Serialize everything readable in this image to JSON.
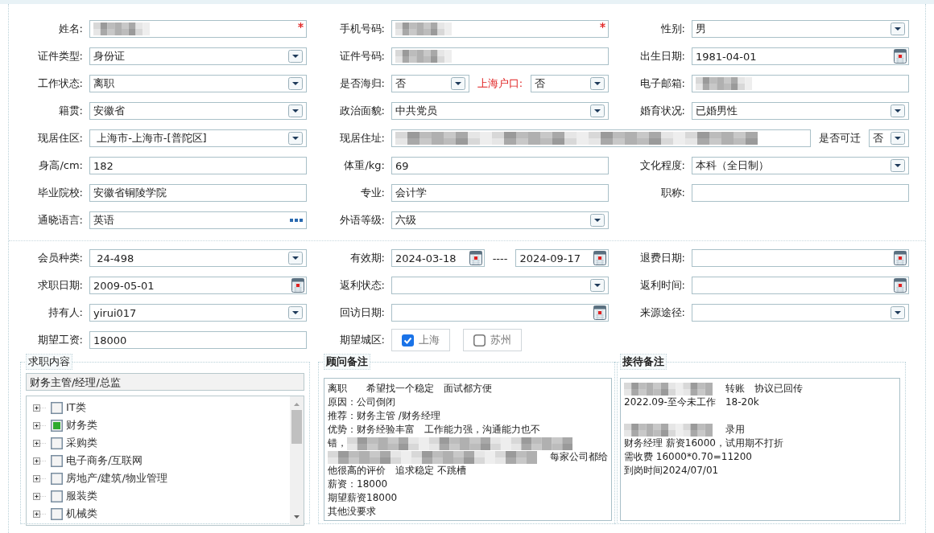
{
  "sections": [
    {
      "rows": [
        {
          "cells": [
            {
              "label": "姓名:",
              "controls": [
                {
                  "kind": "text",
                  "redacted": true,
                  "required": true
                }
              ]
            },
            {
              "label": "手机号码:",
              "controls": [
                {
                  "kind": "text",
                  "redacted": true,
                  "required": true
                }
              ]
            },
            {
              "label": "性别:",
              "controls": [
                {
                  "kind": "select",
                  "value": "男"
                }
              ]
            }
          ]
        },
        {
          "cells": [
            {
              "label": "证件类型:",
              "controls": [
                {
                  "kind": "select",
                  "value": "身份证"
                }
              ]
            },
            {
              "label": "证件号码:",
              "controls": [
                {
                  "kind": "text",
                  "redacted": true
                }
              ]
            },
            {
              "label": "出生日期:",
              "controls": [
                {
                  "kind": "date",
                  "value": "1981-04-01"
                }
              ]
            }
          ]
        },
        {
          "cells": [
            {
              "label": "工作状态:",
              "controls": [
                {
                  "kind": "select",
                  "value": "离职"
                }
              ]
            },
            {
              "label": "是否海归:",
              "controls": [
                {
                  "kind": "select",
                  "value": "否"
                },
                {
                  "kind": "label",
                  "text": "上海户口:",
                  "alert": true
                },
                {
                  "kind": "select",
                  "value": "否"
                }
              ]
            },
            {
              "label": "电子邮箱:",
              "controls": [
                {
                  "kind": "text",
                  "redacted": true
                }
              ]
            }
          ]
        },
        {
          "cells": [
            {
              "label": "籍贯:",
              "controls": [
                {
                  "kind": "select",
                  "value": "安徽省"
                }
              ]
            },
            {
              "label": "政治面貌:",
              "controls": [
                {
                  "kind": "select",
                  "value": "中共党员"
                }
              ]
            },
            {
              "label": "婚育状况:",
              "controls": [
                {
                  "kind": "select",
                  "value": "已婚男性"
                }
              ]
            }
          ]
        },
        {
          "cells": [
            {
              "label": "现居住区:",
              "controls": [
                {
                  "kind": "select",
                  "value": " 上海市-上海市-[普陀区]"
                }
              ]
            },
            {
              "label": "现居住址:",
              "wide": true,
              "controls": [
                {
                  "kind": "text",
                  "redacted": true
                },
                {
                  "kind": "label",
                  "text": "是否可迁",
                  "alert": false
                },
                {
                  "kind": "select",
                  "value": "否"
                }
              ]
            }
          ]
        },
        {
          "cells": [
            {
              "label": "身高/cm:",
              "controls": [
                {
                  "kind": "text",
                  "value": "182"
                }
              ]
            },
            {
              "label": "体重/kg:",
              "controls": [
                {
                  "kind": "text",
                  "value": "69"
                }
              ]
            },
            {
              "label": "文化程度:",
              "controls": [
                {
                  "kind": "select",
                  "value": "本科（全日制）"
                }
              ]
            }
          ]
        },
        {
          "cells": [
            {
              "label": "毕业院校:",
              "controls": [
                {
                  "kind": "text",
                  "value": "安徽省铜陵学院"
                }
              ]
            },
            {
              "label": "专业:",
              "controls": [
                {
                  "kind": "text",
                  "value": "会计学"
                }
              ]
            },
            {
              "label": "职称:",
              "controls": [
                {
                  "kind": "text"
                }
              ]
            }
          ]
        },
        {
          "cells": [
            {
              "label": "通晓语言:",
              "controls": [
                {
                  "kind": "lookup",
                  "value": "英语"
                }
              ]
            },
            {
              "label": "外语等级:",
              "controls": [
                {
                  "kind": "select",
                  "value": "六级"
                }
              ]
            }
          ]
        }
      ]
    },
    {
      "rows": [
        {
          "cells": [
            {
              "label": "会员种类:",
              "controls": [
                {
                  "kind": "select",
                  "value": " 24-498"
                }
              ]
            },
            {
              "label": "有效期:",
              "controls": [
                {
                  "kind": "date",
                  "value": "2024-03-18"
                },
                {
                  "kind": "label",
                  "text": "----",
                  "alert": false
                },
                {
                  "kind": "date",
                  "value": "2024-09-17"
                }
              ]
            },
            {
              "label": "退费日期:",
              "controls": [
                {
                  "kind": "date"
                }
              ]
            }
          ]
        },
        {
          "cells": [
            {
              "label": "求职日期:",
              "controls": [
                {
                  "kind": "date",
                  "value": "2009-05-01"
                }
              ]
            },
            {
              "label": "返利状态:",
              "controls": [
                {
                  "kind": "select"
                }
              ]
            },
            {
              "label": "返利时间:",
              "controls": [
                {
                  "kind": "date"
                }
              ]
            }
          ]
        },
        {
          "cells": [
            {
              "label": "持有人:",
              "controls": [
                {
                  "kind": "select",
                  "value": "yirui017"
                }
              ]
            },
            {
              "label": "回访日期:",
              "controls": [
                {
                  "kind": "date"
                }
              ]
            },
            {
              "label": "来源途径:",
              "controls": [
                {
                  "kind": "select"
                }
              ]
            }
          ]
        },
        {
          "cells": [
            {
              "label": "期望工资:",
              "controls": [
                {
                  "kind": "text",
                  "value": "18000"
                }
              ]
            },
            {
              "label": "期望城区:",
              "controls": [
                {
                  "kind": "checkbox",
                  "text": "上海",
                  "checked": true
                },
                {
                  "kind": "checkbox",
                  "text": "苏州",
                  "checked": false
                }
              ]
            }
          ]
        }
      ]
    }
  ],
  "job_panel": {
    "title": "求职内容",
    "selection": "财务主管/经理/总监",
    "tree": [
      {
        "label": "IT类",
        "checked": false
      },
      {
        "label": "财务类",
        "checked": true
      },
      {
        "label": "采购类",
        "checked": false
      },
      {
        "label": "电子商务/互联网",
        "checked": false
      },
      {
        "label": "房地产/建筑/物业管理",
        "checked": false
      },
      {
        "label": "服装类",
        "checked": false
      },
      {
        "label": "机械类",
        "checked": false
      }
    ]
  },
  "notes": [
    {
      "title": "顾问备注",
      "lines": [
        {
          "text": "离职　　希望找一个稳定　面试都方便"
        },
        {
          "text": "原因：公司倒闭"
        },
        {
          "text": "推荐：财务主管 /财务经理"
        },
        {
          "text": "优势：财务经验丰富　工作能力强，沟通能力也不"
        },
        {
          "text": "错，",
          "redacted_after": true
        },
        {
          "text": "每家公司都给",
          "redacted_before": true
        },
        {
          "text": "他很高的评价　追求稳定 不跳槽"
        },
        {
          "text": "薪资：18000"
        },
        {
          "text": "期望薪资18000"
        },
        {
          "text": "其他没要求"
        }
      ]
    },
    {
      "title": "接待备注",
      "lines": [
        {
          "text": "转账　协议已回传",
          "redacted_before": true
        },
        {
          "text": "2022.09-至今未工作　18-20k"
        },
        {
          "text": "录用",
          "redacted_before": true,
          "space_above": true
        },
        {
          "text": "财务经理 薪资16000，试用期不打折"
        },
        {
          "text": "需收费 16000*0.70=11200"
        },
        {
          "text": "到岗时间2024/07/01"
        }
      ]
    }
  ]
}
